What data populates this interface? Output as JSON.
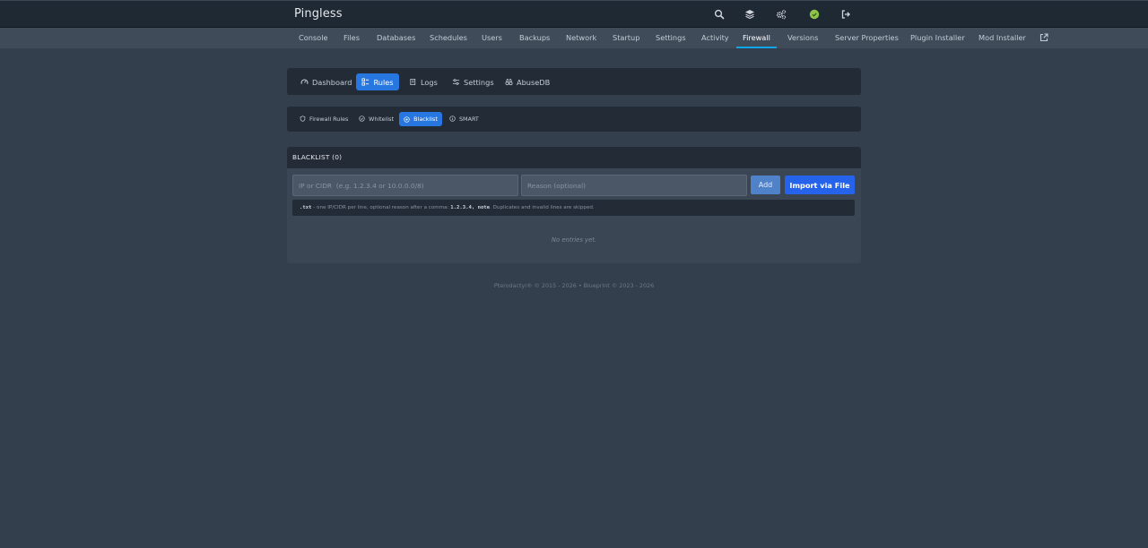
{
  "app": {
    "title": "Pingless"
  },
  "topbar": {
    "icons": [
      "search-icon",
      "layers-icon",
      "cogs-icon",
      "status-icon",
      "logout-icon"
    ],
    "status_color": "#8fc44a"
  },
  "subnav": {
    "items": [
      {
        "label": "Console"
      },
      {
        "label": "Files"
      },
      {
        "label": "Databases"
      },
      {
        "label": "Schedules"
      },
      {
        "label": "Users"
      },
      {
        "label": "Backups"
      },
      {
        "label": "Network"
      },
      {
        "label": "Startup"
      },
      {
        "label": "Settings"
      },
      {
        "label": "Activity"
      },
      {
        "label": "Firewall"
      },
      {
        "label": "Versions"
      },
      {
        "label": "Server Properties"
      },
      {
        "label": "Plugin Installer"
      },
      {
        "label": "Mod Installer"
      }
    ],
    "active": "Firewall",
    "accent": "#0ea5e9"
  },
  "tabs": {
    "items": [
      {
        "label": "Dashboard"
      },
      {
        "label": "Rules"
      },
      {
        "label": "Logs"
      },
      {
        "label": "Settings"
      },
      {
        "label": "AbuseDB"
      }
    ],
    "active": "Rules",
    "accent": "#2877e0"
  },
  "subtabs": {
    "items": [
      {
        "label": "Firewall Rules"
      },
      {
        "label": "Whitelist"
      },
      {
        "label": "Blacklist"
      },
      {
        "label": "SMART"
      }
    ],
    "active": "Blacklist"
  },
  "blacklist": {
    "title": "BLACKLIST (0)",
    "ip_placeholder": "IP or CIDR  (e.g. 1.2.3.4 or 10.0.0.0/8)",
    "reason_placeholder": "Reason (optional)",
    "add_label": "Add",
    "import_label": "Import via File",
    "hint": {
      "ext": ".txt",
      "text1": " - one IP/CIDR per line, optional reason after a comma: ",
      "example": "1.2.3.4, note",
      "text2": ". Duplicates and invalid lines are skipped."
    },
    "empty_text": "No entries yet."
  },
  "footer": {
    "text": "Pterodactyl® © 2015 - 2026  •  Blueprint © 2023 - 2026"
  }
}
